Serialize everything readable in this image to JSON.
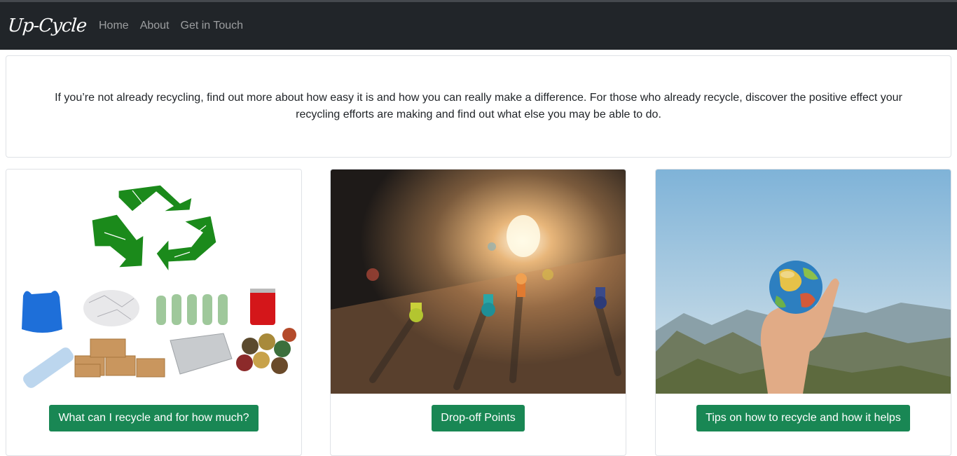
{
  "navbar": {
    "brand": "Up-Cycle",
    "links": [
      "Home",
      "About",
      "Get in Touch"
    ]
  },
  "intro": {
    "text": "If you’re not already recycling, find out more about how easy it is and how you can really make a difference. For those who already recycle, discover the positive effect your recycling efforts are making and find out what else you may be able to do."
  },
  "cards": [
    {
      "button": "What can I recycle and for how much?",
      "image": "recycling-symbol-and-items"
    },
    {
      "button": "Drop-off Points",
      "image": "map-with-pushpins"
    },
    {
      "button": "Tips on how to recycle and how it helps",
      "image": "hand-holding-globe"
    }
  ],
  "colors": {
    "navbar": "#212529",
    "button": "#198754",
    "recycle_green": "#1b8a1b"
  }
}
